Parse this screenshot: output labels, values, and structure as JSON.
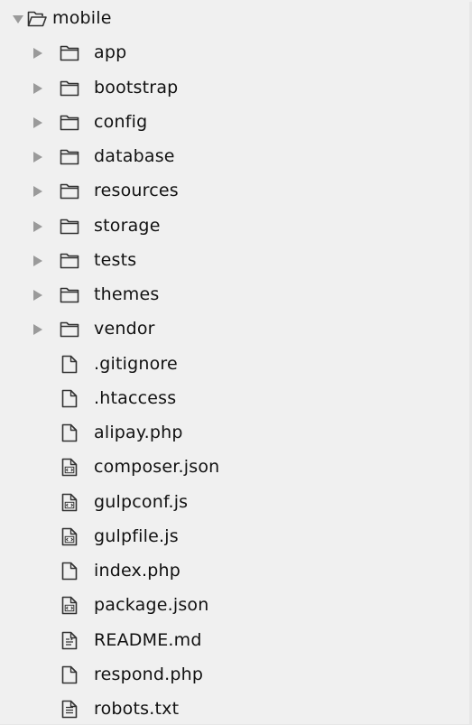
{
  "root": {
    "name": "mobile",
    "expanded": true,
    "icon": "folder-open-icon"
  },
  "folders": [
    {
      "name": "app",
      "icon": "folder-icon",
      "expanded": false
    },
    {
      "name": "bootstrap",
      "icon": "folder-icon",
      "expanded": false
    },
    {
      "name": "config",
      "icon": "folder-icon",
      "expanded": false
    },
    {
      "name": "database",
      "icon": "folder-icon",
      "expanded": false
    },
    {
      "name": "resources",
      "icon": "folder-icon",
      "expanded": false
    },
    {
      "name": "storage",
      "icon": "folder-icon",
      "expanded": false
    },
    {
      "name": "tests",
      "icon": "folder-icon",
      "expanded": false
    },
    {
      "name": "themes",
      "icon": "folder-icon",
      "expanded": false
    },
    {
      "name": "vendor",
      "icon": "folder-icon",
      "expanded": false
    }
  ],
  "files": [
    {
      "name": ".gitignore",
      "icon": "file-icon"
    },
    {
      "name": ".htaccess",
      "icon": "file-icon"
    },
    {
      "name": "alipay.php",
      "icon": "file-icon"
    },
    {
      "name": "composer.json",
      "icon": "code-file-icon"
    },
    {
      "name": "gulpconf.js",
      "icon": "code-file-icon"
    },
    {
      "name": "gulpfile.js",
      "icon": "code-file-icon"
    },
    {
      "name": "index.php",
      "icon": "file-icon"
    },
    {
      "name": "package.json",
      "icon": "code-file-icon"
    },
    {
      "name": "README.md",
      "icon": "markdown-file-icon"
    },
    {
      "name": "respond.php",
      "icon": "file-icon"
    },
    {
      "name": "robots.txt",
      "icon": "text-file-icon"
    }
  ],
  "colors": {
    "background": "#f0f0f0",
    "text": "#111111",
    "arrow": "#9a9a9a",
    "icon_stroke": "#333333"
  }
}
